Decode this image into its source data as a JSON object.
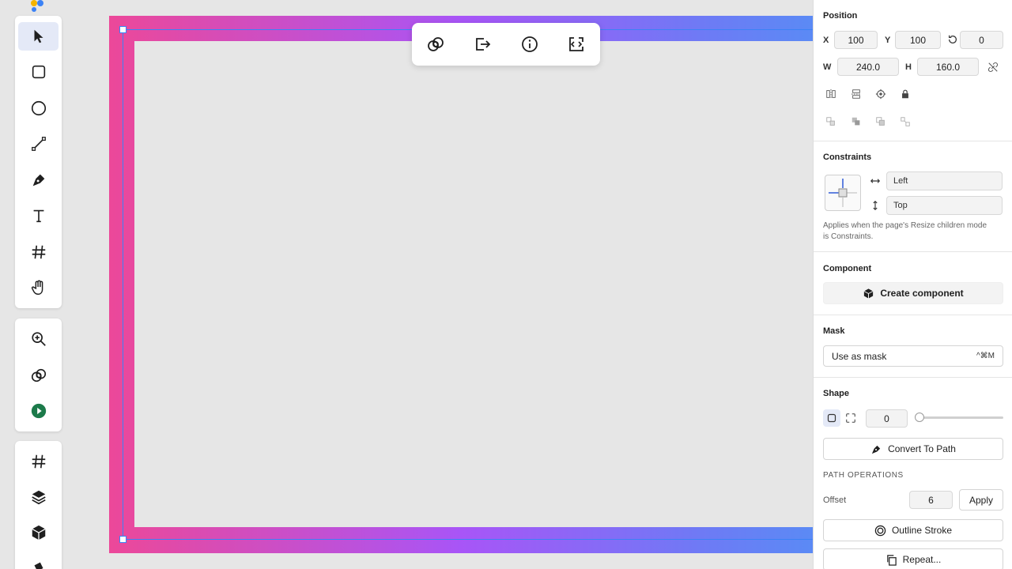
{
  "toolbar": {
    "tools": [
      {
        "name": "select",
        "icon": "cursor-icon",
        "active": true
      },
      {
        "name": "rectangle",
        "icon": "rectangle-icon"
      },
      {
        "name": "ellipse",
        "icon": "ellipse-icon"
      },
      {
        "name": "line",
        "icon": "line-icon"
      },
      {
        "name": "pen",
        "icon": "pen-icon"
      },
      {
        "name": "text",
        "icon": "text-icon"
      },
      {
        "name": "frame",
        "icon": "hash-icon"
      },
      {
        "name": "hand",
        "icon": "hand-icon"
      }
    ],
    "secondary": [
      {
        "name": "zoom",
        "icon": "zoom-in-icon"
      },
      {
        "name": "boolean",
        "icon": "boolean-ops-icon"
      },
      {
        "name": "play",
        "icon": "play-icon"
      }
    ],
    "bottom": [
      {
        "name": "frame",
        "icon": "hash-icon"
      },
      {
        "name": "layers",
        "icon": "layers-icon"
      },
      {
        "name": "components",
        "icon": "cube-icon"
      }
    ]
  },
  "floating_toolbar": {
    "items": [
      "boolean-ops-icon",
      "export-icon",
      "info-icon",
      "code-icon"
    ]
  },
  "panel": {
    "position": {
      "title": "Position",
      "x_label": "X",
      "x": "100",
      "y_label": "Y",
      "y": "100",
      "rotation": "0",
      "w_label": "W",
      "w": "240.0",
      "h_label": "H",
      "h": "160.0"
    },
    "constraints": {
      "title": "Constraints",
      "horizontal": "Left",
      "vertical": "Top",
      "note": "Applies when the page's Resize children mode is Constraints."
    },
    "component": {
      "title": "Component",
      "create_label": "Create component"
    },
    "mask": {
      "title": "Mask",
      "use_label": "Use as mask",
      "shortcut": "^⌘M"
    },
    "shape": {
      "title": "Shape",
      "radius": "0",
      "radius_slider": 0,
      "convert_label": "Convert To Path",
      "path_ops_title": "PATH OPERATIONS",
      "offset_label": "Offset",
      "offset_value": "6",
      "apply_label": "Apply",
      "outline_label": "Outline Stroke",
      "repeat_label": "Repeat..."
    }
  },
  "colors": {
    "gradient_start": "#ec4899",
    "gradient_mid": "#a855f7",
    "gradient_end": "#5b8af5",
    "selection": "#3b82f6",
    "active_tool": "#e4e9f7"
  }
}
